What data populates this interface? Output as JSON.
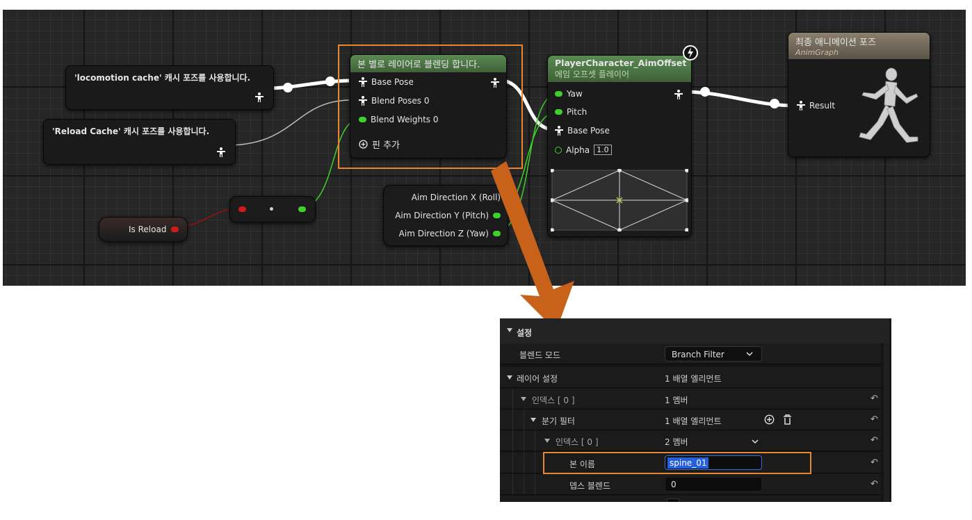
{
  "graph": {
    "cache_nodes": [
      {
        "title": "'locomotion cache' 캐시 포즈를 사용합니다."
      },
      {
        "title": "'Reload Cache' 캐시 포즈를 사용합니다."
      }
    ],
    "layered_blend": {
      "title": "본 별로 레이어로 블렌딩 합니다.",
      "pins": [
        "Base Pose",
        "Blend Poses 0",
        "Blend Weights 0"
      ],
      "add_pin": "핀 추가",
      "accent": "#4e7a47"
    },
    "aim_offset": {
      "title": "PlayerCharacter_AimOffset",
      "subtitle": "에임 오프셋 플레이어",
      "pins": [
        "Yaw",
        "Pitch",
        "Base Pose",
        "Alpha"
      ],
      "alpha_value": "1.0",
      "accent": "#4e7a47"
    },
    "final_pose": {
      "title": "최종 애니메이션 포즈",
      "subtitle": "AnimGraph",
      "pin": "Result",
      "accent": "#7a6f5e"
    },
    "is_reload": {
      "label": "Is Reload"
    },
    "aim_direction": {
      "pins": [
        "Aim Direction X (Roll)",
        "Aim Direction Y (Pitch)",
        "Aim Direction Z (Yaw)"
      ]
    },
    "colors": {
      "highlight": "#e8872e",
      "arrow": "#c8621a",
      "exec_green": "#3fd12b",
      "bool_red": "#d01b1b"
    }
  },
  "details": {
    "section": "설정",
    "rows": [
      {
        "name": "블렌드 모드",
        "value": "Branch Filter"
      },
      {
        "name": "레이어 설정",
        "value": "1 배열 엘리먼트"
      },
      {
        "name": "인덱스 [ 0 ]",
        "value": "1 멤버"
      },
      {
        "name": "분기 필터",
        "value": "1 배열 엘리먼트"
      },
      {
        "name": "인덱스 [ 0 ]",
        "value": "2 멤버"
      },
      {
        "name": "본 이름",
        "value": "spine_01"
      },
      {
        "name": "뎁스 블렌드",
        "value": "0"
      }
    ]
  }
}
